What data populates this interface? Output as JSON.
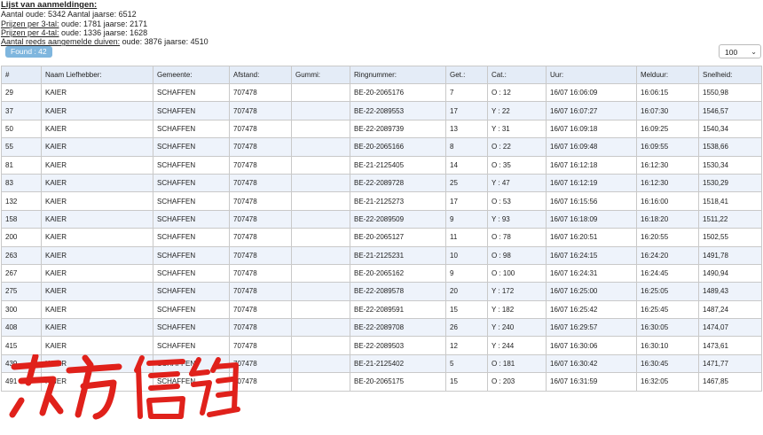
{
  "summary": {
    "title": "Lijst van aanmeldingen:",
    "line1": "Aantal oude: 5342 Aantal jaarse: 6512",
    "line2_label": "Prijzen per 3-tal:",
    "line2_value": " oude: 1781 jaarse: 2171",
    "line3_label": "Prijzen per 4-tal:",
    "line3_value": " oude: 1336 jaarse: 1628",
    "line4_label": "Aantal reeds aangemelde duiven:",
    "line4_value": " oude: 3876 jaarse: 4510"
  },
  "found_badge": "Found : 42",
  "page_size": {
    "selected": "100",
    "icon": "chevron-down-icon"
  },
  "table": {
    "headers": [
      "#",
      "Naam Liefhebber:",
      "Gemeente:",
      "Afstand:",
      "Gummi:",
      "Ringnummer:",
      "Get.:",
      "Cat.:",
      "Uur:",
      "Melduur:",
      "Snelheid:"
    ],
    "rows": [
      [
        "29",
        "KAIER",
        "SCHAFFEN",
        "707478",
        "",
        "BE-20-2065176",
        "7",
        "O : 12",
        "16/07 16:06:09",
        "16:06:15",
        "1550,98"
      ],
      [
        "37",
        "KAIER",
        "SCHAFFEN",
        "707478",
        "",
        "BE-22-2089553",
        "17",
        "Y : 22",
        "16/07 16:07:27",
        "16:07:30",
        "1546,57"
      ],
      [
        "50",
        "KAIER",
        "SCHAFFEN",
        "707478",
        "",
        "BE-22-2089739",
        "13",
        "Y : 31",
        "16/07 16:09:18",
        "16:09:25",
        "1540,34"
      ],
      [
        "55",
        "KAIER",
        "SCHAFFEN",
        "707478",
        "",
        "BE-20-2065166",
        "8",
        "O : 22",
        "16/07 16:09:48",
        "16:09:55",
        "1538,66"
      ],
      [
        "81",
        "KAIER",
        "SCHAFFEN",
        "707478",
        "",
        "BE-21-2125405",
        "14",
        "O : 35",
        "16/07 16:12:18",
        "16:12:30",
        "1530,34"
      ],
      [
        "83",
        "KAIER",
        "SCHAFFEN",
        "707478",
        "",
        "BE-22-2089728",
        "25",
        "Y : 47",
        "16/07 16:12:19",
        "16:12:30",
        "1530,29"
      ],
      [
        "132",
        "KAIER",
        "SCHAFFEN",
        "707478",
        "",
        "BE-21-2125273",
        "17",
        "O : 53",
        "16/07 16:15:56",
        "16:16:00",
        "1518,41"
      ],
      [
        "158",
        "KAIER",
        "SCHAFFEN",
        "707478",
        "",
        "BE-22-2089509",
        "9",
        "Y : 93",
        "16/07 16:18:09",
        "16:18:20",
        "1511,22"
      ],
      [
        "200",
        "KAIER",
        "SCHAFFEN",
        "707478",
        "",
        "BE-20-2065127",
        "11",
        "O : 78",
        "16/07 16:20:51",
        "16:20:55",
        "1502,55"
      ],
      [
        "263",
        "KAIER",
        "SCHAFFEN",
        "707478",
        "",
        "BE-21-2125231",
        "10",
        "O : 98",
        "16/07 16:24:15",
        "16:24:20",
        "1491,78"
      ],
      [
        "267",
        "KAIER",
        "SCHAFFEN",
        "707478",
        "",
        "BE-20-2065162",
        "9",
        "O : 100",
        "16/07 16:24:31",
        "16:24:45",
        "1490,94"
      ],
      [
        "275",
        "KAIER",
        "SCHAFFEN",
        "707478",
        "",
        "BE-22-2089578",
        "20",
        "Y : 172",
        "16/07 16:25:00",
        "16:25:05",
        "1489,43"
      ],
      [
        "300",
        "KAIER",
        "SCHAFFEN",
        "707478",
        "",
        "BE-22-2089591",
        "15",
        "Y : 182",
        "16/07 16:25:42",
        "16:25:45",
        "1487,24"
      ],
      [
        "408",
        "KAIER",
        "SCHAFFEN",
        "707478",
        "",
        "BE-22-2089708",
        "26",
        "Y : 240",
        "16/07 16:29:57",
        "16:30:05",
        "1474,07"
      ],
      [
        "415",
        "KAIER",
        "SCHAFFEN",
        "707478",
        "",
        "BE-22-2089503",
        "12",
        "Y : 244",
        "16/07 16:30:06",
        "16:30:10",
        "1473,61"
      ],
      [
        "439",
        "KAIER",
        "SCHAFFEN",
        "707478",
        "",
        "BE-21-2125402",
        "5",
        "O : 181",
        "16/07 16:30:42",
        "16:30:45",
        "1471,77"
      ],
      [
        "491",
        "KAIER",
        "SCHAFFEN",
        "707478",
        "",
        "BE-20-2065175",
        "15",
        "O : 203",
        "16/07 16:31:59",
        "16:32:05",
        "1467,85"
      ]
    ]
  },
  "watermark": {
    "text": "东方信鸽",
    "color": "#e0211b"
  }
}
